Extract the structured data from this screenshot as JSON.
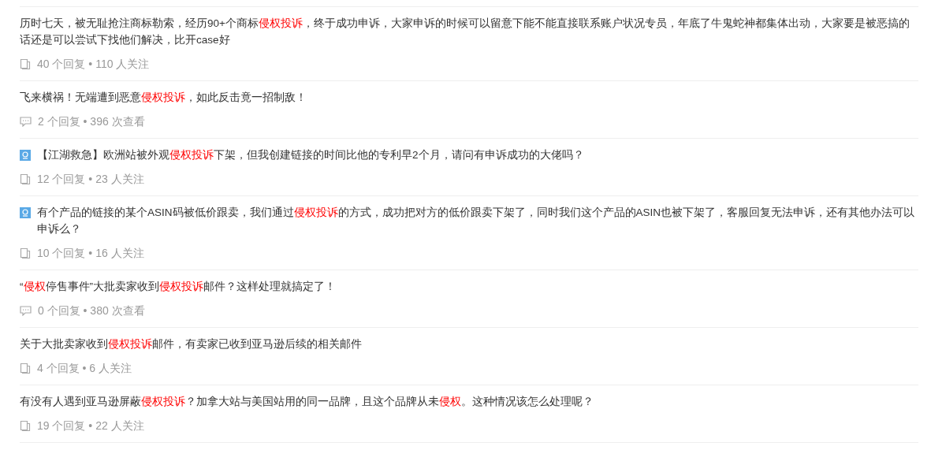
{
  "posts": [
    {
      "badge": false,
      "title": [
        {
          "text": "历时七天，被无耻抢注商标勒索，经历90+个商标",
          "highlight": false
        },
        {
          "text": "侵权投诉",
          "highlight": true
        },
        {
          "text": "，终于成功申诉，大家申诉的时候可以留意下能不能直接联系账户状况专员，年底了牛鬼蛇神都集体出动，大家要是被恶搞的话还是可以尝试下找他们解决，比开case好",
          "highlight": false
        }
      ],
      "kind": "question",
      "stats": "40 个回复 • 110 人关注"
    },
    {
      "badge": false,
      "title": [
        {
          "text": "飞来横祸！无端遭到恶意",
          "highlight": false
        },
        {
          "text": "侵权投诉",
          "highlight": true
        },
        {
          "text": "，如此反击竟一招制敌！",
          "highlight": false
        }
      ],
      "kind": "article",
      "stats": "2 个回复 • 396 次查看"
    },
    {
      "badge": true,
      "title": [
        {
          "text": "【江湖救急】欧洲站被外观",
          "highlight": false
        },
        {
          "text": "侵权投诉",
          "highlight": true
        },
        {
          "text": "下架，但我创建链接的时间比他的专利早2个月，请问有申诉成功的大佬吗？",
          "highlight": false
        }
      ],
      "kind": "question",
      "stats": "12 个回复 • 23 人关注"
    },
    {
      "badge": true,
      "title": [
        {
          "text": "有个产品的链接的某个ASIN码被低价跟卖，我们通过",
          "highlight": false
        },
        {
          "text": "侵权投诉",
          "highlight": true
        },
        {
          "text": "的方式，成功把对方的低价跟卖下架了，同时我们这个产品的ASIN也被下架了，客服回复无法申诉，还有其他办法可以申诉么？",
          "highlight": false
        }
      ],
      "kind": "question",
      "stats": "10 个回复 • 16 人关注"
    },
    {
      "badge": false,
      "title": [
        {
          "text": "“",
          "highlight": false
        },
        {
          "text": "侵权",
          "highlight": true
        },
        {
          "text": "停售事件”大批卖家收到",
          "highlight": false
        },
        {
          "text": "侵权投诉",
          "highlight": true
        },
        {
          "text": "邮件？这样处理就搞定了！",
          "highlight": false
        }
      ],
      "kind": "article",
      "stats": "0 个回复 • 380 次查看"
    },
    {
      "badge": false,
      "title": [
        {
          "text": "关于大批卖家收到",
          "highlight": false
        },
        {
          "text": "侵权投诉",
          "highlight": true
        },
        {
          "text": "邮件，有卖家已收到亚马逊后续的相关邮件",
          "highlight": false
        }
      ],
      "kind": "question",
      "stats": "4 个回复 • 6 人关注"
    },
    {
      "badge": false,
      "title": [
        {
          "text": "有没有人遇到亚马逊屏蔽",
          "highlight": false
        },
        {
          "text": "侵权投诉",
          "highlight": true
        },
        {
          "text": "？加拿大站与美国站用的同一品牌，且这个品牌从未",
          "highlight": false
        },
        {
          "text": "侵权",
          "highlight": true
        },
        {
          "text": "。这种情况该怎么处理呢？",
          "highlight": false
        }
      ],
      "kind": "question",
      "stats": "19 个回复 • 22 人关注"
    }
  ]
}
